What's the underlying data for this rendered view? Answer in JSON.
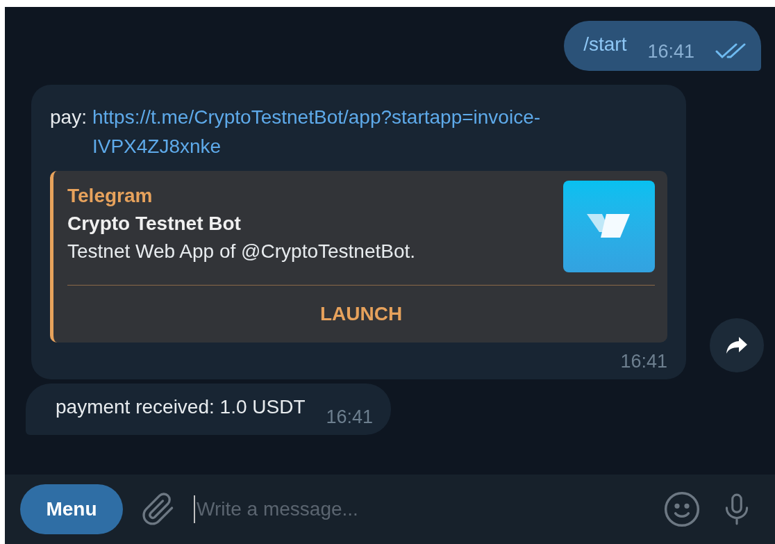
{
  "messages": [
    {
      "kind": "outgoing",
      "text": "/start",
      "time": "16:41",
      "read": true
    },
    {
      "kind": "preview",
      "prefix": "pay:",
      "link": "https://t.me/CryptoTestnetBot/app?startapp=invoice-IVPX4ZJ8xnke",
      "preview": {
        "site": "Telegram",
        "title": "Crypto Testnet Bot",
        "description": "Testnet Web App of @CryptoTestnetBot.",
        "action": "LAUNCH"
      },
      "time": "16:41",
      "forwardable": true
    },
    {
      "kind": "incoming",
      "text": "payment received: 1.0 USDT",
      "time": "16:41"
    }
  ],
  "composer": {
    "menu": "Menu",
    "placeholder": "Write a message..."
  }
}
